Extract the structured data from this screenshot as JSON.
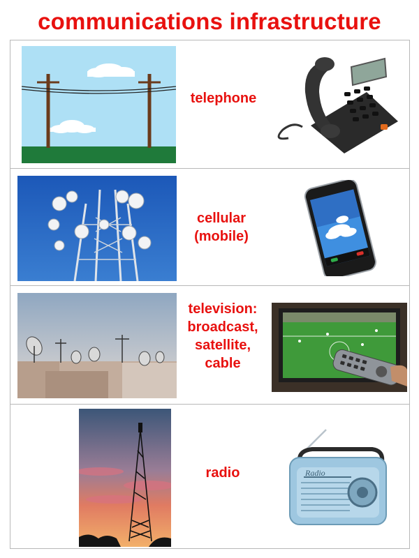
{
  "title": "communications infrastructure",
  "accent_color": "#e8110f",
  "rows": [
    {
      "label": "telephone",
      "left_image": "telephone-poles-illustration",
      "right_image": "desk-telephone"
    },
    {
      "label": "cellular\n(mobile)",
      "left_image": "cell-tower-antennas",
      "right_image": "smartphone"
    },
    {
      "label": "television:\nbroadcast,\nsatellite,\ncable",
      "left_image": "rooftop-satellite-dishes",
      "right_image": "tv-with-remote"
    },
    {
      "label": "radio",
      "left_image": "radio-tower-at-sunset",
      "right_image": "retro-radio"
    }
  ],
  "radio_brand": "Radio"
}
